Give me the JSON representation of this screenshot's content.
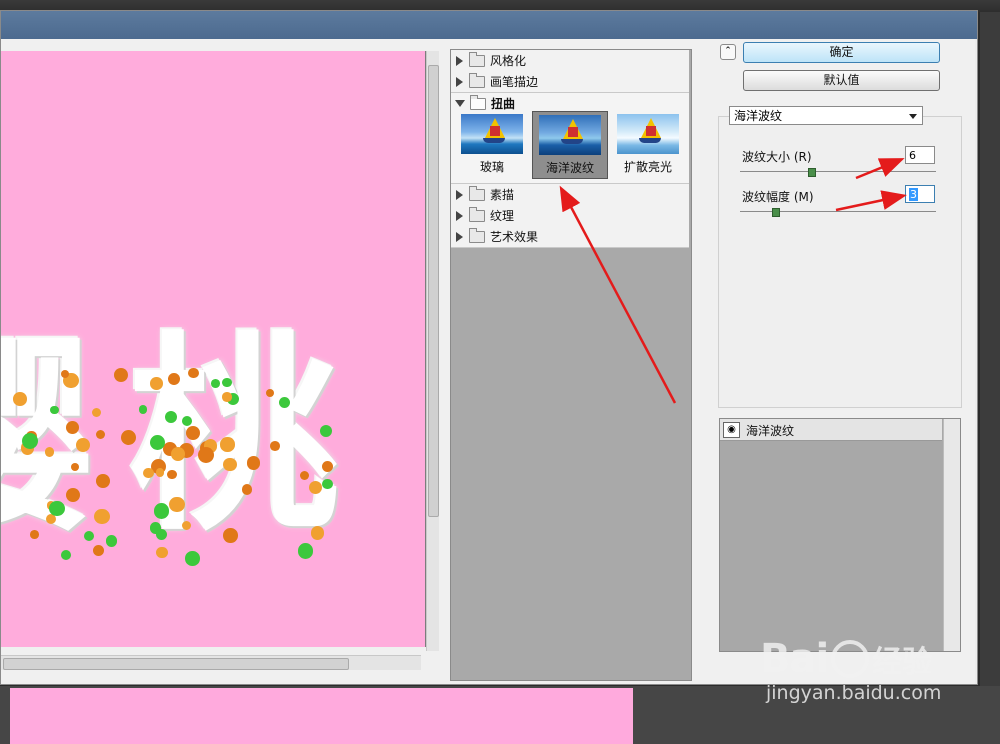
{
  "preview": {
    "chars": [
      "樱",
      "桃"
    ]
  },
  "filter_tree": {
    "categories": [
      {
        "label": "风格化",
        "expanded": false
      },
      {
        "label": "画笔描边",
        "expanded": false
      },
      {
        "label": "扭曲",
        "expanded": true
      },
      {
        "label": "素描",
        "expanded": false
      },
      {
        "label": "纹理",
        "expanded": false
      },
      {
        "label": "艺术效果",
        "expanded": false
      }
    ],
    "thumbnails": [
      {
        "label": "玻璃",
        "selected": false
      },
      {
        "label": "海洋波纹",
        "selected": true
      },
      {
        "label": "扩散亮光",
        "selected": false
      }
    ]
  },
  "right_panel": {
    "ok_label": "确定",
    "default_label": "默认值",
    "filter_select": "海洋波纹",
    "params": [
      {
        "label": "波纹大小 (R)",
        "value": "6"
      },
      {
        "label": "波纹幅度 (M)",
        "value": "3"
      }
    ],
    "slider_levels": [
      0.36,
      0.18
    ]
  },
  "layers": {
    "items": [
      {
        "label": "海洋波纹"
      }
    ]
  },
  "watermark": {
    "brand": "Bai",
    "brand_cn": "经验",
    "url": "jingyan.baidu.com"
  },
  "colors": {
    "preview_bg": "#ffacdc",
    "arrow": "#e41b1b",
    "ok_button": "#bde4f8"
  }
}
